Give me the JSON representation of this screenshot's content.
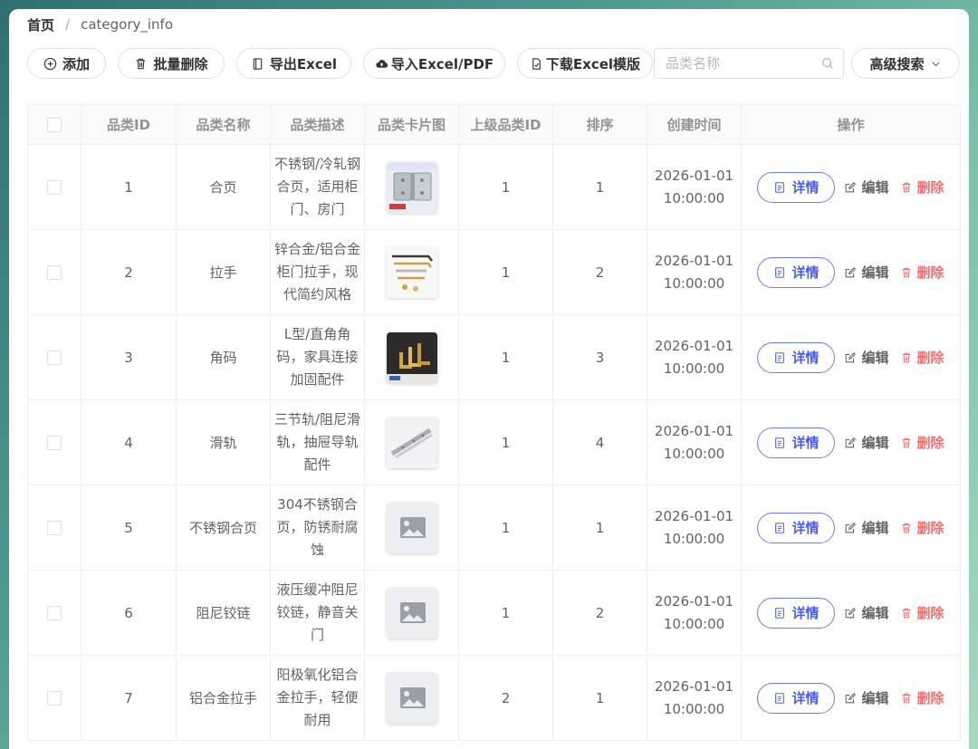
{
  "breadcrumb": {
    "home": "首页",
    "separator": "/",
    "current": "category_info"
  },
  "toolbar": {
    "add": "添加",
    "batch_delete": "批量删除",
    "export_excel": "导出Excel",
    "import": "导入Excel/PDF",
    "download_template": "下载Excel模版",
    "search_placeholder": "品类名称",
    "advanced_search": "高级搜索"
  },
  "table": {
    "headers": [
      "品类ID",
      "品类名称",
      "品类描述",
      "品类卡片图",
      "上级品类ID",
      "排序",
      "创建时间",
      "操作"
    ],
    "action_labels": {
      "detail": "详情",
      "edit": "编辑",
      "delete": "删除"
    },
    "rows": [
      {
        "id": "1",
        "name": "合页",
        "desc_lines": [
          "不锈钢/冷轧钢",
          "合页，适用柜",
          "门、房门"
        ],
        "image": "hinge-photo",
        "parent_id": "1",
        "sort": "1",
        "created_date": "2026-01-01",
        "created_time": "10:00:00"
      },
      {
        "id": "2",
        "name": "拉手",
        "desc_lines": [
          "锌合金/铝合金",
          "柜门拉手，现",
          "代简约风格"
        ],
        "image": "handle-photo",
        "parent_id": "1",
        "sort": "2",
        "created_date": "2026-01-01",
        "created_time": "10:00:00"
      },
      {
        "id": "3",
        "name": "角码",
        "desc_lines": [
          "L型/直角角",
          "码，家具连接",
          "加固配件"
        ],
        "image": "corner-bracket-photo",
        "parent_id": "1",
        "sort": "3",
        "created_date": "2026-01-01",
        "created_time": "10:00:00"
      },
      {
        "id": "4",
        "name": "滑轨",
        "desc_lines": [
          "三节轨/阻尼滑",
          "轨，抽屉导轨",
          "配件"
        ],
        "image": "slide-rail-photo",
        "parent_id": "1",
        "sort": "4",
        "created_date": "2026-01-01",
        "created_time": "10:00:00"
      },
      {
        "id": "5",
        "name": "不锈钢合页",
        "desc_lines": [
          "304不锈钢合",
          "页，防锈耐腐",
          "蚀"
        ],
        "image": "image-placeholder-icon",
        "parent_id": "1",
        "sort": "1",
        "created_date": "2026-01-01",
        "created_time": "10:00:00"
      },
      {
        "id": "6",
        "name": "阻尼铰链",
        "desc_lines": [
          "液压缓冲阻尼",
          "铰链，静音关",
          "门"
        ],
        "image": "image-placeholder-icon",
        "parent_id": "1",
        "sort": "2",
        "created_date": "2026-01-01",
        "created_time": "10:00:00"
      },
      {
        "id": "7",
        "name": "铝合金拉手",
        "desc_lines": [
          "阳极氧化铝合",
          "金拉手，轻便",
          "耐用"
        ],
        "image": "image-placeholder-icon",
        "parent_id": "2",
        "sort": "1",
        "created_date": "2026-01-01",
        "created_time": "10:00:00"
      }
    ]
  },
  "colors": {
    "primary": "#4a5ee8",
    "danger": "#f56c6c",
    "border": "#ebeef5"
  }
}
